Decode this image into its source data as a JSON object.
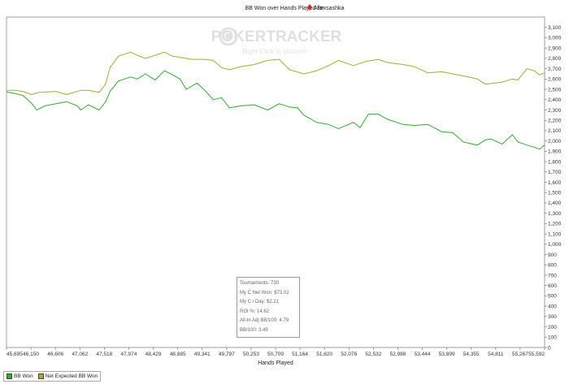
{
  "title_prefix": "BB Won over Hands Played for",
  "player": "Allexsashka",
  "colors": {
    "bb_won": "#33aa33",
    "net_expected": "#aaaa33",
    "logo_icon": "#d8232a"
  },
  "watermark": {
    "brand": "POKERTRACKER",
    "subtitle": "Right-Click to Unzoom"
  },
  "chart_data": {
    "type": "line",
    "title": "BB Won over Hands Played for Allexsashka",
    "xlabel": "Hands Played",
    "ylabel": "",
    "xlim": [
      45695,
      55592
    ],
    "ylim": [
      0,
      3200
    ],
    "x_ticks": [
      "45,695",
      "46,150",
      "46,606",
      "47,062",
      "47,518",
      "47,974",
      "48,429",
      "48,885",
      "49,341",
      "49,797",
      "50,253",
      "50,709",
      "51,164",
      "51,620",
      "52,076",
      "52,532",
      "52,988",
      "53,444",
      "53,899",
      "54,355",
      "54,811",
      "55,267",
      "55,592"
    ],
    "y_ticks": [
      "0",
      "100",
      "200",
      "300",
      "400",
      "500",
      "600",
      "700",
      "800",
      "900",
      "1,000",
      "1,100",
      "1,200",
      "1,300",
      "1,400",
      "1,500",
      "1,600",
      "1,700",
      "1,800",
      "1,900",
      "2,000",
      "2,100",
      "2,200",
      "2,300",
      "2,400",
      "2,500",
      "2,600",
      "2,700",
      "2,800",
      "2,900",
      "3,000",
      "3,100"
    ],
    "grid": false,
    "legend_position": "bottom-left",
    "series": [
      {
        "name": "BB Won",
        "x": [
          45695,
          45850,
          46000,
          46150,
          46250,
          46400,
          46606,
          46800,
          47000,
          47062,
          47200,
          47400,
          47518,
          47600,
          47750,
          47974,
          48100,
          48250,
          48429,
          48600,
          48750,
          48885,
          49000,
          49200,
          49341,
          49500,
          49650,
          49797,
          50000,
          50253,
          50500,
          50709,
          50900,
          51050,
          51164,
          51400,
          51620,
          51800,
          52076,
          52200,
          52350,
          52532,
          52700,
          52988,
          53200,
          53444,
          53700,
          53899,
          54100,
          54355,
          54500,
          54600,
          54811,
          55000,
          55100,
          55267,
          55400,
          55500,
          55592
        ],
        "y": [
          2475,
          2460,
          2440,
          2370,
          2300,
          2340,
          2360,
          2380,
          2340,
          2300,
          2350,
          2300,
          2380,
          2480,
          2580,
          2620,
          2600,
          2650,
          2590,
          2680,
          2640,
          2600,
          2500,
          2560,
          2490,
          2400,
          2420,
          2320,
          2340,
          2350,
          2300,
          2360,
          2330,
          2320,
          2250,
          2180,
          2160,
          2120,
          2180,
          2130,
          2260,
          2260,
          2210,
          2160,
          2150,
          2160,
          2090,
          2080,
          1990,
          1960,
          2010,
          2020,
          1970,
          2060,
          1990,
          1960,
          1940,
          1920,
          1960
        ]
      },
      {
        "name": "Net Expected BB Won",
        "x": [
          45695,
          45850,
          46000,
          46150,
          46300,
          46606,
          46800,
          47062,
          47200,
          47400,
          47518,
          47600,
          47750,
          47974,
          48100,
          48250,
          48429,
          48600,
          48750,
          48885,
          49100,
          49341,
          49500,
          49650,
          49797,
          50000,
          50253,
          50500,
          50709,
          50900,
          51164,
          51400,
          51620,
          51800,
          52076,
          52300,
          52532,
          52700,
          52988,
          53200,
          53444,
          53700,
          53899,
          54100,
          54355,
          54500,
          54811,
          55000,
          55100,
          55267,
          55400,
          55500,
          55592
        ],
        "y": [
          2490,
          2490,
          2480,
          2450,
          2470,
          2480,
          2450,
          2490,
          2490,
          2470,
          2550,
          2710,
          2820,
          2860,
          2830,
          2800,
          2830,
          2860,
          2820,
          2810,
          2790,
          2790,
          2780,
          2710,
          2690,
          2720,
          2740,
          2780,
          2790,
          2690,
          2650,
          2680,
          2730,
          2780,
          2730,
          2770,
          2790,
          2760,
          2740,
          2720,
          2660,
          2670,
          2650,
          2630,
          2600,
          2550,
          2570,
          2600,
          2590,
          2700,
          2680,
          2640,
          2660
        ]
      }
    ]
  }
}
